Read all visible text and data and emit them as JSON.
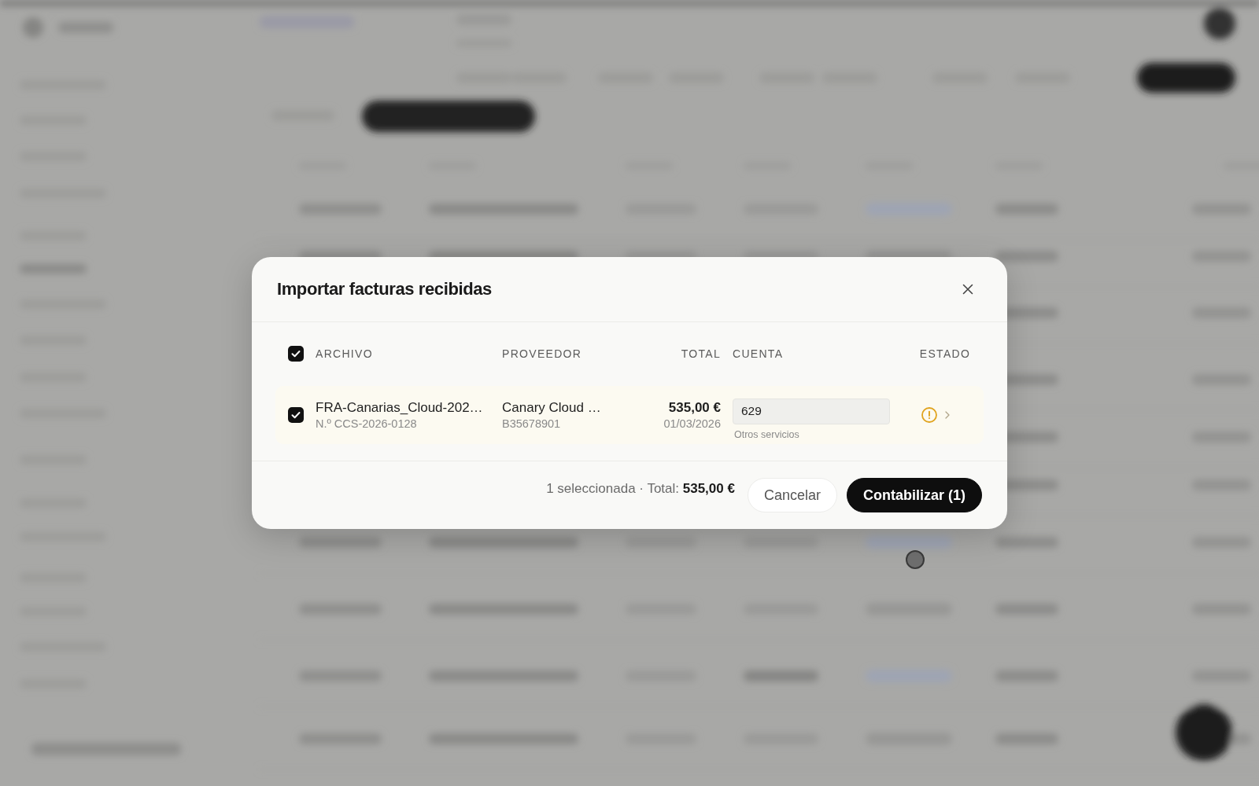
{
  "dialog": {
    "title": "Importar facturas recibidas",
    "table": {
      "select_all": {
        "checked": true
      },
      "columns": [
        "ARCHIVO",
        "PROVEEDOR",
        "TOTAL",
        "CUENTA",
        "ESTADO"
      ],
      "rows": [
        {
          "checked": true,
          "file": "FRA-Canarias_Cloud-202…",
          "number": "N.º CCS-2026-0128",
          "supplier": "Canary Cloud …",
          "tax_id": "B35678901",
          "total": "535,00 €",
          "date": "01/03/2026",
          "account": {
            "value": "629",
            "name": "Otros servicios"
          },
          "warning": true
        }
      ]
    },
    "footer": {
      "summary": "1 seleccionada · Total: **535,00 €**",
      "buttons": [
        {
          "label": "Cancelar",
          "kind": "secondary"
        },
        {
          "label": "Contabilizar (1)",
          "kind": "primary"
        }
      ]
    }
  }
}
